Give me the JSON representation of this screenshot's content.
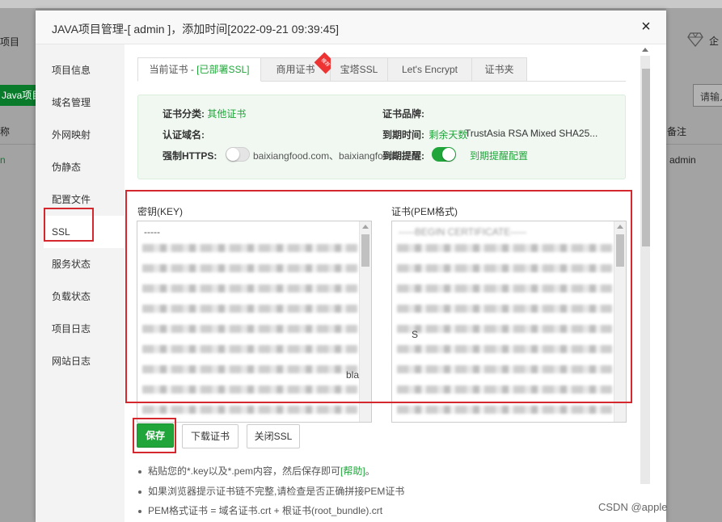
{
  "background": {
    "left_labels": [
      "项目",
      "称"
    ],
    "java_button": "Java项目",
    "row_value": "n",
    "right_header": "备注",
    "right_value": "admin",
    "search_placeholder": "请输入",
    "top_right_text": "企"
  },
  "dialog": {
    "title": "JAVA项目管理-[ admin ]，添加时间[2022-09-21 09:39:45]",
    "close_label": "×"
  },
  "sidenav": {
    "items": [
      {
        "label": "项目信息"
      },
      {
        "label": "域名管理"
      },
      {
        "label": "外网映射"
      },
      {
        "label": "伪静态"
      },
      {
        "label": "配置文件"
      },
      {
        "label": "SSL"
      },
      {
        "label": "服务状态"
      },
      {
        "label": "负载状态"
      },
      {
        "label": "项目日志"
      },
      {
        "label": "网站日志"
      }
    ],
    "active_index": 5
  },
  "tabs": {
    "current_prefix": "当前证书 - ",
    "current_status": "[已部署SSL]",
    "items": [
      "商用证书",
      "宝塔SSL",
      "Let's Encrypt",
      "证书夹"
    ],
    "ribbon": "推荐"
  },
  "cert_info": {
    "category_label": "证书分类:",
    "category_value": "其他证书",
    "brand_label": "证书品牌:",
    "domain_label": "认证域名:",
    "expiry_label": "到期时间:",
    "expiry_overlap_text": "剩余天数",
    "brand_value": "TrustAsia RSA Mixed SHA25...",
    "force_https_label": "强制HTTPS:",
    "domain_value": "baixiangfood.com、baixiangfood.c...",
    "reminder_label": "到期提醒:",
    "reminder_link": "到期提醒配置",
    "force_https_on": false,
    "reminder_on": true
  },
  "key_field": {
    "label": "密钥(KEY)",
    "visible_tail": "bla",
    "first_line": "-----"
  },
  "cert_field": {
    "label": "证书(PEM格式)",
    "first_line": "-----BEGIN CERTIFICATE-----",
    "visible_char": "S"
  },
  "buttons": {
    "save": "保存",
    "download": "下载证书",
    "close_ssl": "关闭SSL"
  },
  "tips": [
    {
      "text": "粘贴您的*.key以及*.pem内容，然后保存即可",
      "link": "[帮助]",
      "suffix": "。"
    },
    {
      "text": "如果浏览器提示证书链不完整,请检查是否正确拼接PEM证书",
      "link": "",
      "suffix": ""
    },
    {
      "text": "PEM格式证书 = 域名证书.crt + 根证书(root_bundle).crt",
      "link": "",
      "suffix": ""
    }
  ],
  "watermark": "CSDN @apple",
  "colors": {
    "accent": "#20a53a",
    "highlight_frame": "#d4272e",
    "ribbon": "#ee3333"
  }
}
